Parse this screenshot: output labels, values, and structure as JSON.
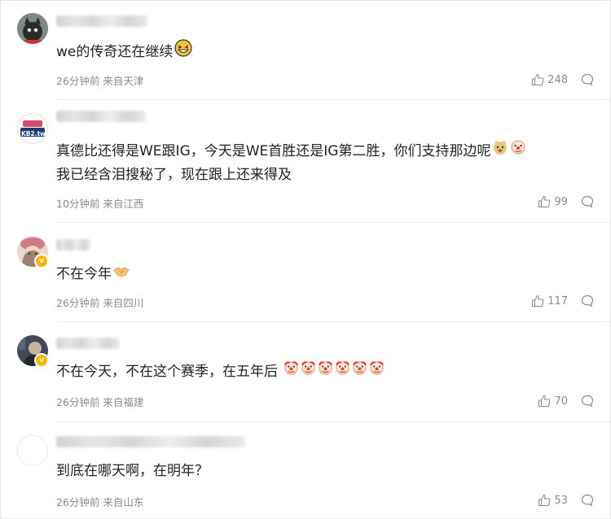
{
  "comments": [
    {
      "text": "we的传奇还在继续",
      "time": "26分钟前",
      "location": "来自天津",
      "likes": "248",
      "emoji": [
        "laughing-emoji"
      ]
    },
    {
      "text": "真德比还得是WE跟IG，今天是WE首胜还是IG第二胜，你们支持那边呢",
      "text2": "我已经含泪搜秘了，现在跟上还来得及",
      "time": "10分钟前",
      "location": "来自江西",
      "likes": "99",
      "avatar_text": "KB2.tw",
      "emoji": [
        "doge-emoji",
        "clown-emoji"
      ]
    },
    {
      "text": "不在今年",
      "time": "26分钟前",
      "location": "来自四川",
      "likes": "117",
      "emoji": [
        "handshake-emoji"
      ]
    },
    {
      "text": "不在今天，不在这个赛季，在五年后",
      "time": "26分钟前",
      "location": "来自福建",
      "likes": "70",
      "emoji": [
        "clown-emoji",
        "clown-emoji",
        "clown-emoji",
        "clown-emoji",
        "clown-emoji",
        "clown-emoji"
      ]
    },
    {
      "text": "到底在哪天啊，在明年？",
      "time": "26分钟前",
      "location": "来自山东",
      "likes": "53",
      "emoji": []
    }
  ],
  "colors": {
    "text": "#222222",
    "meta": "#8b8b8b",
    "badge": "#f7b500",
    "divider": "#ececec"
  }
}
